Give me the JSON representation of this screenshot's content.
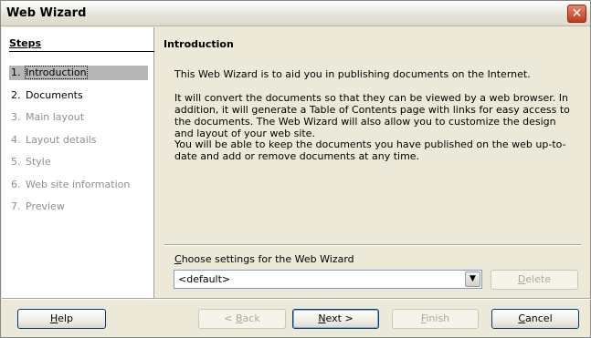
{
  "window": {
    "title": "Web Wizard",
    "close_icon": "close-icon"
  },
  "steps": {
    "header": "Steps",
    "items": [
      {
        "num": "1.",
        "label": "Introduction",
        "state": "active"
      },
      {
        "num": "2.",
        "label": "Documents",
        "state": "enabled"
      },
      {
        "num": "3.",
        "label": "Main layout",
        "state": "disabled"
      },
      {
        "num": "4.",
        "label": "Layout details",
        "state": "disabled"
      },
      {
        "num": "5.",
        "label": "Style",
        "state": "disabled"
      },
      {
        "num": "6.",
        "label": "Web site information",
        "state": "disabled"
      },
      {
        "num": "7.",
        "label": "Preview",
        "state": "disabled"
      }
    ]
  },
  "content": {
    "title": "Introduction",
    "para1": "This Web Wizard is to aid you in publishing documents on the Internet.",
    "para2": "It will convert the documents so that they can be viewed by a web browser. In addition, it will generate a Table of Contents page with links for easy access to the documents. The Web Wizard will also allow you to customize the design and layout of your web site.",
    "para3": "You will be able to keep the documents you have published on the web up-to-date and add or remove documents at any time."
  },
  "settings": {
    "label_first": "C",
    "label_rest": "hoose settings for the Web Wizard",
    "select_value": "<default>",
    "delete_first": "D",
    "delete_rest": "elete"
  },
  "buttons": {
    "help_first": "H",
    "help_rest": "elp",
    "back_prefix": "< ",
    "back_first": "B",
    "back_rest": "ack",
    "next_first": "N",
    "next_rest": "ext >",
    "finish_first": "F",
    "finish_rest": "inish",
    "cancel_first": "C",
    "cancel_rest": "ancel"
  }
}
